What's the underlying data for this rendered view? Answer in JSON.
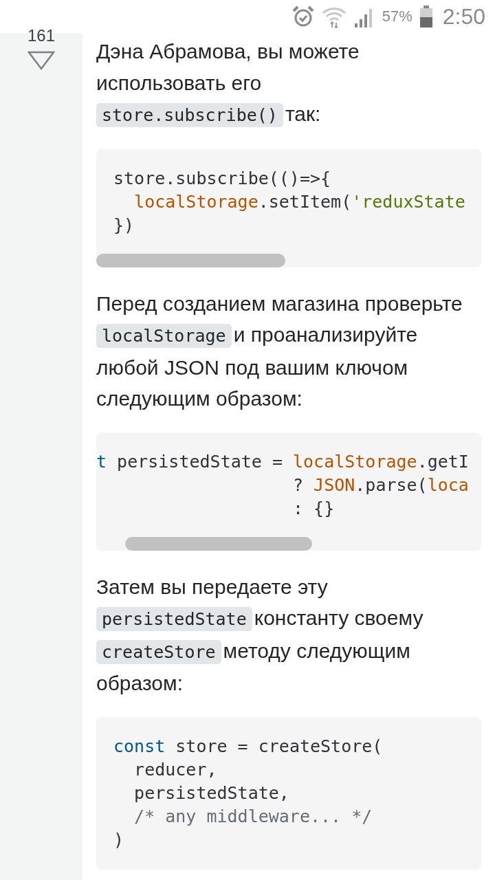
{
  "status_bar": {
    "battery_percent": "57%",
    "time": "2:50"
  },
  "vote": {
    "count": "161"
  },
  "content": [
    {
      "kind": "paragraph",
      "parts": [
        {
          "kind": "text",
          "text": "Дэна Абрамова, вы можете использовать его "
        },
        {
          "kind": "code",
          "text": "store.subscribe()"
        },
        {
          "kind": "text",
          "text": "так:"
        }
      ]
    },
    {
      "kind": "codeblock",
      "scrollable": true,
      "scrolled": false,
      "lines": [
        [
          {
            "kind": "plain",
            "text": "store.subscribe(()=>{"
          }
        ],
        [
          {
            "kind": "builtin",
            "text": "  localStorage"
          },
          {
            "kind": "plain",
            "text": ".setItem("
          },
          {
            "kind": "string",
            "text": "'reduxState"
          }
        ],
        [
          {
            "kind": "plain",
            "text": "})"
          }
        ]
      ]
    },
    {
      "kind": "paragraph",
      "parts": [
        {
          "kind": "text",
          "text": "Перед созданием магазина проверьте "
        },
        {
          "kind": "code",
          "text": "localStorage"
        },
        {
          "kind": "text",
          "text": "и проанализируйте любой JSON под вашим ключом следующим образом:"
        }
      ]
    },
    {
      "kind": "codeblock",
      "scrollable": true,
      "scrolled": true,
      "lines": [
        [
          {
            "kind": "keyword",
            "text": "t"
          },
          {
            "kind": "plain",
            "text": " persistedState = "
          },
          {
            "kind": "builtin",
            "text": "localStorage"
          },
          {
            "kind": "plain",
            "text": ".getI"
          }
        ],
        [
          {
            "kind": "plain",
            "text": "                   ? "
          },
          {
            "kind": "builtin",
            "text": "JSON"
          },
          {
            "kind": "plain",
            "text": ".parse("
          },
          {
            "kind": "builtin",
            "text": "loca"
          }
        ],
        [
          {
            "kind": "plain",
            "text": "                   : {}"
          }
        ]
      ]
    },
    {
      "kind": "paragraph",
      "parts": [
        {
          "kind": "text",
          "text": "Затем вы передаете эту "
        },
        {
          "kind": "code",
          "text": "persistedState"
        },
        {
          "kind": "text",
          "text": "константу своему "
        },
        {
          "kind": "code",
          "text": "createStore"
        },
        {
          "kind": "text",
          "text": "методу следующим образом:"
        }
      ]
    },
    {
      "kind": "codeblock",
      "scrollable": false,
      "lines": [
        [
          {
            "kind": "keyword",
            "text": "const"
          },
          {
            "kind": "plain",
            "text": " store = createStore("
          }
        ],
        [
          {
            "kind": "plain",
            "text": "  reducer,"
          }
        ],
        [
          {
            "kind": "plain",
            "text": "  persistedState,"
          }
        ],
        [
          {
            "kind": "comment",
            "text": "  /* any middleware... */"
          }
        ],
        [
          {
            "kind": "plain",
            "text": ")"
          }
        ]
      ]
    }
  ]
}
